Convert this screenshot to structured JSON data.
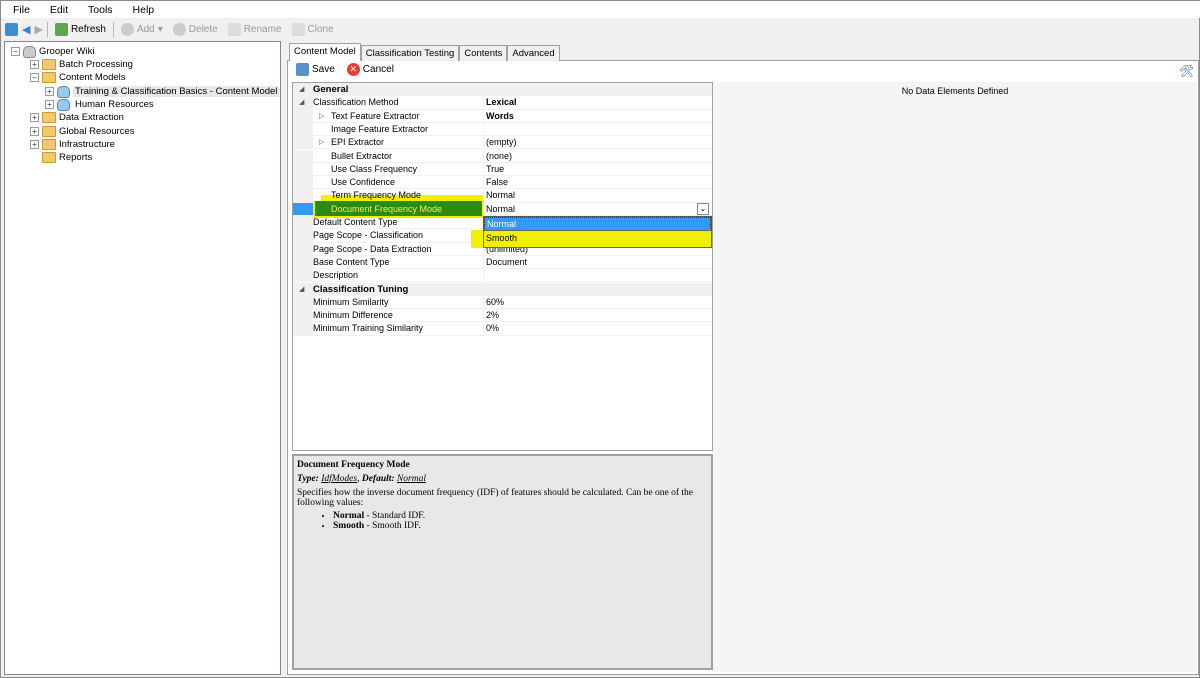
{
  "menu": [
    "File",
    "Edit",
    "Tools",
    "Help"
  ],
  "toolbar": {
    "refresh": "Refresh",
    "add": "Add",
    "delete": "Delete",
    "rename": "Rename",
    "clone": "Clone"
  },
  "tree": {
    "root": "Grooper Wiki",
    "items": [
      "Batch Processing",
      "Content Models",
      "Training & Classification Basics - Content Model",
      "Human Resources",
      "Data Extraction",
      "Global Resources",
      "Infrastructure",
      "Reports"
    ]
  },
  "tabs": [
    "Content Model",
    "Classification Testing",
    "Contents",
    "Advanced"
  ],
  "actions": {
    "save": "Save",
    "cancel": "Cancel"
  },
  "grid": {
    "general": "General",
    "rows": [
      {
        "name": "Classification Method",
        "value": "Lexical"
      },
      {
        "name": "Text Feature Extractor",
        "value": "Words"
      },
      {
        "name": "Image Feature Extractor",
        "value": ""
      },
      {
        "name": "EPI Extractor",
        "value": "(empty)"
      },
      {
        "name": "Bullet Extractor",
        "value": "(none)"
      },
      {
        "name": "Use Class Frequency",
        "value": "True"
      },
      {
        "name": "Use Confidence",
        "value": "False"
      },
      {
        "name": "Term Frequency Mode",
        "value": "Normal"
      },
      {
        "name": "Document Frequency Mode",
        "value": "Normal"
      },
      {
        "name": "Default Content Type",
        "value": ""
      },
      {
        "name": "Page Scope - Classification",
        "value": ""
      },
      {
        "name": "Page Scope - Data Extraction",
        "value": "(unlimited)"
      },
      {
        "name": "Base Content Type",
        "value": "Document"
      },
      {
        "name": "Description",
        "value": ""
      }
    ],
    "tuning": "Classification Tuning",
    "tuning_rows": [
      {
        "name": "Minimum Similarity",
        "value": "60%"
      },
      {
        "name": "Minimum Difference",
        "value": "2%"
      },
      {
        "name": "Minimum Training Similarity",
        "value": "0%"
      }
    ]
  },
  "dropdown": {
    "options": [
      "Normal",
      "Smooth"
    ]
  },
  "help": {
    "title": "Document Frequency Mode",
    "type_label": "Type:",
    "type": "IdfModes",
    "default_label": "Default:",
    "default": "Normal",
    "desc": "Specifies how the inverse document frequency (IDF) of features should be calculated. Can be one of the following values:",
    "items": [
      {
        "name": "Normal",
        "desc": " - Standard IDF."
      },
      {
        "name": "Smooth",
        "desc": " - Smooth IDF."
      }
    ]
  },
  "right": {
    "empty": "No Data Elements Defined"
  },
  "colors": {
    "highlight": "#f0f000",
    "selected": "#3399ff",
    "green": "#2e8b12"
  }
}
